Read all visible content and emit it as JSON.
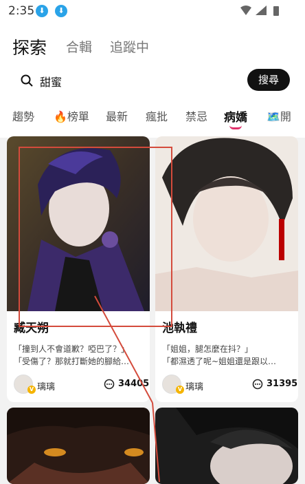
{
  "status": {
    "time": "2:35"
  },
  "tabs": {
    "explore": "探索",
    "collection": "合輯",
    "following": "追蹤中"
  },
  "search": {
    "query": "甜蜜",
    "button": "搜尋"
  },
  "categories": [
    "趨勢",
    "🔥榜單",
    "最新",
    "瘋批",
    "禁忌",
    "病嬌",
    "🗺️開"
  ],
  "cards": [
    {
      "name": "臧天朔",
      "desc1": "「撞到人不會道歉？啞巴了？」",
      "desc2": "「受傷了？那就打斷她的腳給…",
      "author": "璃璃",
      "count": "34405"
    },
    {
      "name": "池執禮",
      "desc1": "「姐姐，腿怎麼在抖？」",
      "desc2": "「都濕透了呢~姐姐還是跟以…",
      "author": "璃璃",
      "count": "31395"
    }
  ],
  "badge": "V"
}
